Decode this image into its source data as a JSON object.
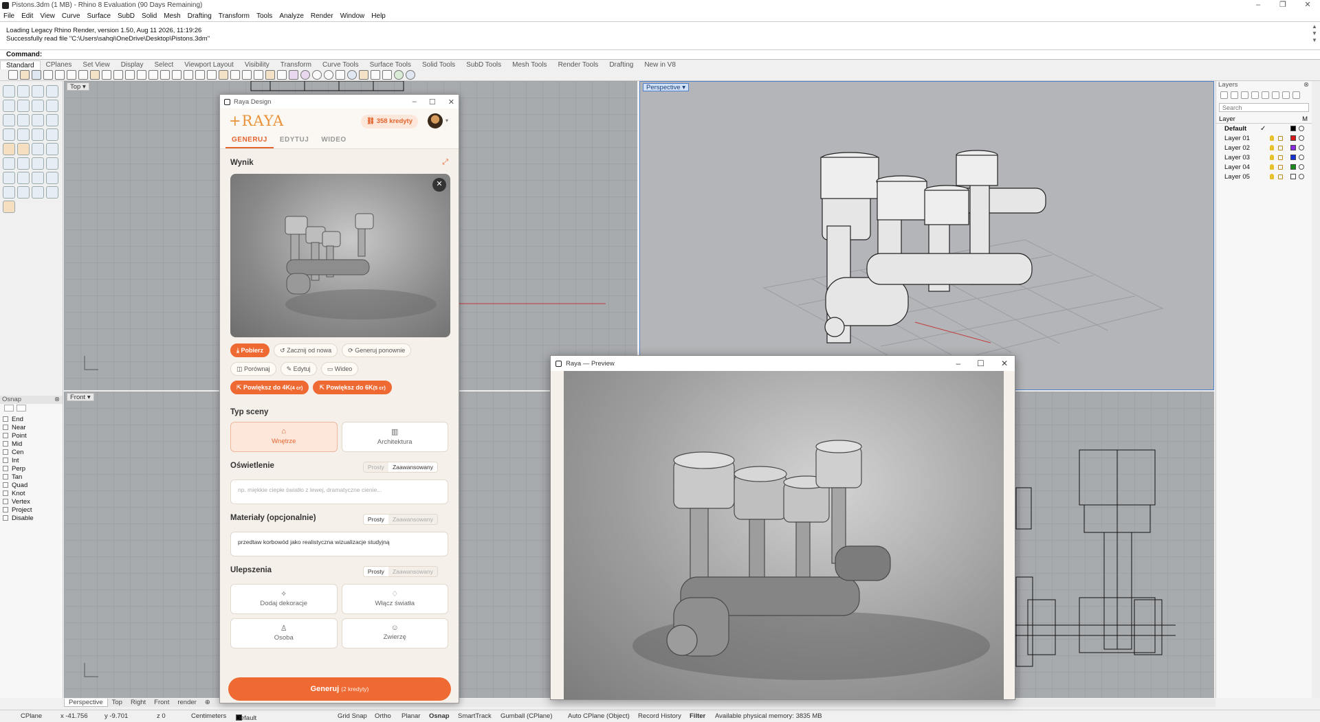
{
  "window": {
    "title": "Pistons.3dm (1 MB) - Rhino 8 Evaluation (90 Days Remaining)"
  },
  "menu": [
    "File",
    "Edit",
    "View",
    "Curve",
    "Surface",
    "SubD",
    "Solid",
    "Mesh",
    "Drafting",
    "Transform",
    "Tools",
    "Analyze",
    "Render",
    "Window",
    "Help"
  ],
  "command_history": [
    "Loading Legacy Rhino Render, version 1.50, Aug 11 2026, 11:19:26",
    "Successfully read file \"C:\\Users\\sahqi\\OneDrive\\Desktop\\Pistons.3dm\""
  ],
  "command_prompt": "Command:",
  "toolbar_tabs": [
    "Standard",
    "CPlanes",
    "Set View",
    "Display",
    "Select",
    "Viewport Layout",
    "Visibility",
    "Transform",
    "Curve Tools",
    "Surface Tools",
    "Solid Tools",
    "SubD Tools",
    "Mesh Tools",
    "Render Tools",
    "Drafting",
    "New in V8"
  ],
  "viewports": {
    "top": "Top",
    "perspective": "Perspective",
    "front": "Front"
  },
  "osnap": {
    "title": "Osnap",
    "items": [
      "End",
      "Near",
      "Point",
      "Mid",
      "Cen",
      "Int",
      "Perp",
      "Tan",
      "Quad",
      "Knot",
      "Vertex",
      "Project",
      "Disable"
    ]
  },
  "layers": {
    "title": "Layers",
    "search_placeholder": "Search",
    "col_layer": "Layer",
    "col_m": "M",
    "rows": [
      {
        "name": "Default",
        "current": "✓",
        "color": "#000000"
      },
      {
        "name": "Layer 01",
        "color": "#d81b1b"
      },
      {
        "name": "Layer 02",
        "color": "#8a2be2"
      },
      {
        "name": "Layer 03",
        "color": "#1533d8"
      },
      {
        "name": "Layer 04",
        "color": "#1a8a1a"
      },
      {
        "name": "Layer 05",
        "color": "#ffffff"
      }
    ]
  },
  "viewport_tabs": [
    "Perspective",
    "Top",
    "Right",
    "Front",
    "render"
  ],
  "status": {
    "cplane": "CPlane",
    "x": "x -41.756",
    "y": "y -9.701",
    "z": "z 0",
    "units": "Centimeters",
    "layer": "Default",
    "toggles": [
      "Grid Snap",
      "Ortho",
      "Planar",
      "Osnap",
      "SmartTrack",
      "Gumball (CPlane)",
      "Auto CPlane (Object)",
      "Record History",
      "Filter"
    ],
    "memory": "Available physical memory: 3835 MB"
  },
  "raya": {
    "window_title": "Raya Design",
    "logo": "RAYA",
    "credits": "358 kredyty",
    "tabs": [
      "GENERUJ",
      "EDYTUJ",
      "WIDEO"
    ],
    "result_title": "Wynik",
    "actions_row1": [
      "Pobierz",
      "Zacznij od nowa",
      "Generuj ponownie"
    ],
    "actions_row2": [
      "Porównaj",
      "Edytuj",
      "Wideo"
    ],
    "upscale": [
      {
        "label": "Powiększ do 4K",
        "cost": "(4 cr)"
      },
      {
        "label": "Powiększ do 6K",
        "cost": "(5 cr)"
      }
    ],
    "scene_title": "Typ sceny",
    "scenes": [
      "Wnętrze",
      "Architektura"
    ],
    "lighting_title": "Oświetlenie",
    "mode_simple": "Prosty",
    "mode_advanced": "Zaawansowany",
    "lighting_placeholder": "np. miękkie ciepłe światło z lewej, dramatyczne cienie...",
    "materials_title": "Materiały (opcjonalnie)",
    "materials_value": "przedtaw korbowód jako realistyczna wizualizacje studyjną",
    "improvements_title": "Ulepszenia",
    "improvements": [
      "Dodaj dekoracje",
      "Włącz światła",
      "Osoba",
      "Zwierzę"
    ],
    "generate_label": "Generuj",
    "generate_cost": "(2 kredyty)"
  },
  "preview": {
    "window_title": "Raya — Preview"
  }
}
